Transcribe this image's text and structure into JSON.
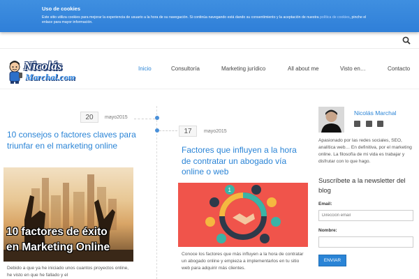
{
  "cookie": {
    "title": "Uso de cookies",
    "text": "Este sitio utiliza cookies para mejorar la experiencia de usuario a la hora de su navegación. Si continúa navegando está dando su consentimiento y la aceptación de nuestra",
    "link": "política de cookies",
    "text_end": ", pinche el enlace para mayor información."
  },
  "logo": {
    "line1": "Nicolás",
    "line2": "Marchal.com"
  },
  "nav": {
    "items": [
      {
        "label": "Inicio"
      },
      {
        "label": "Consultoría"
      },
      {
        "label": "Marketing jurídico"
      },
      {
        "label": "All about me"
      },
      {
        "label": "Visto en…"
      },
      {
        "label": "Contacto"
      }
    ],
    "active_color": "#2a84d6"
  },
  "posts": [
    {
      "day": "20",
      "month": "mayo2015",
      "title": "10 consejos o factores claves para triunfar en el marketing online",
      "image_caption_1": "10 factores de éxito",
      "image_caption_2": "en Marketing Online",
      "excerpt": "Debido a que ya he iniciado unos cuantos proyectos online, he visto en que he fallado y el"
    },
    {
      "day": "17",
      "month": "mayo2015",
      "title": "Factores que influyen a la hora de contratar un abogado vía online o web",
      "excerpt": "Conoce los factores que más influyen a la hora de contratar un abogado online y empieza a implementarlos en tu sitio web para adquirir más clientes."
    }
  ],
  "sidebar": {
    "author": "Nicolás Marchal",
    "bio": "Apasionado por las redes sociales, SEO, analítica web… En definitiva, por el marketing online. La filosofía de mi vida es trabajar y disfrutar con lo que hago.",
    "subscribe_title": "Suscríbete a la newsletter del blog",
    "email_label": "Email:",
    "email_placeholder": "Dirección email",
    "name_label": "Nombre:",
    "name_placeholder": "",
    "submit": "ENVIAR"
  },
  "colors": {
    "banner": "#3486dc",
    "link": "#2a84d6",
    "img2_bg": "#f0544b"
  }
}
